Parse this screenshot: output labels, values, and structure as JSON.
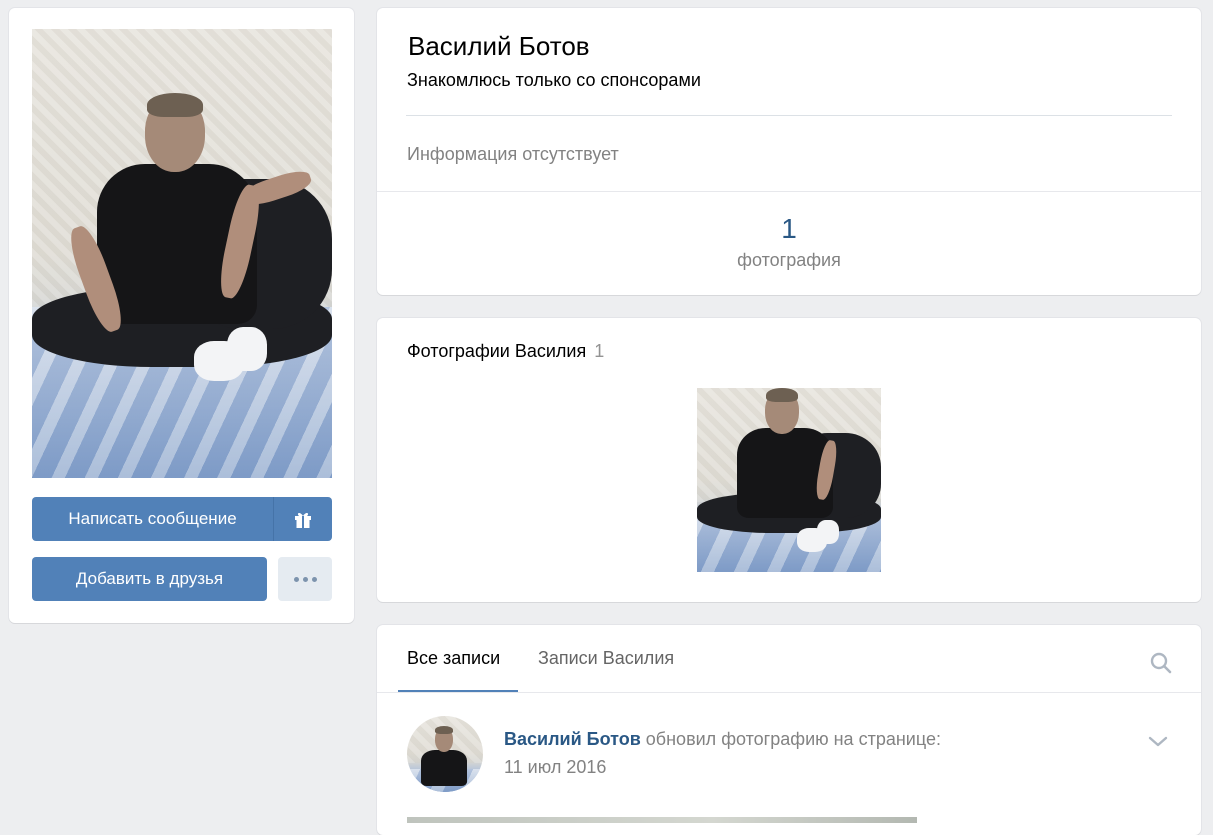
{
  "profile": {
    "name": "Василий Ботов",
    "status": "Знакомлюсь только со спонсорами",
    "info": "Информация отсутствует",
    "counter": {
      "value": "1",
      "label": "фотография"
    }
  },
  "actions": {
    "message_label": "Написать сообщение",
    "add_friend_label": "Добавить в друзья",
    "gift_icon": "gift-icon",
    "more_icon": "more-dots-icon"
  },
  "photos": {
    "title": "Фотографии Василия",
    "count": "1"
  },
  "wall": {
    "tabs": [
      {
        "label": "Все записи",
        "active": true
      },
      {
        "label": "Записи Василия",
        "active": false
      }
    ],
    "search_icon": "search-icon",
    "post": {
      "author": "Василий Ботов",
      "action": "обновил фотографию на странице:",
      "date": "11 июл 2016",
      "menu_icon": "chevron-down-icon"
    }
  },
  "colors": {
    "accent": "#5181b8",
    "link": "#2a5885",
    "muted": "#828282",
    "background": "#edeef0"
  }
}
